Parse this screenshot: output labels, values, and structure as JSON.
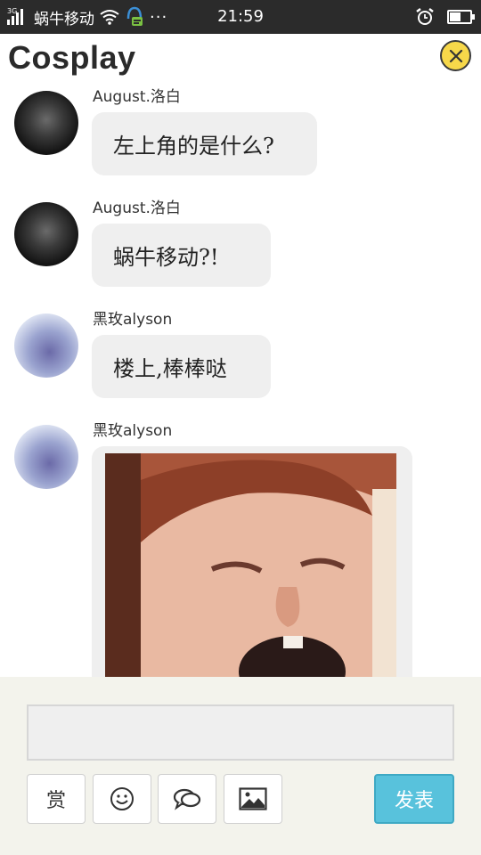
{
  "status_bar": {
    "network": "3G",
    "carrier": "蜗牛移动",
    "more": "···",
    "time": "21:59"
  },
  "header": {
    "title": "Cosplay"
  },
  "messages": [
    {
      "user": "August.洛白",
      "text": "左上角的是什么?"
    },
    {
      "user": "August.洛白",
      "text": "蜗牛移动?!"
    },
    {
      "user": "黑玫alyson",
      "text": "楼上,棒棒哒"
    },
    {
      "user": "黑玫alyson",
      "image": "photo-face"
    }
  ],
  "composer": {
    "reward_label": "赏",
    "post_label": "发表"
  },
  "colors": {
    "status_bar_bg": "#2b2b2b",
    "close_button": "#f7d84a",
    "bubble_bg": "#efefef",
    "post_button": "#58c2dc",
    "composer_bg": "#f3f3ec"
  },
  "icons": [
    "signal-icon",
    "wifi-icon",
    "notification-icon",
    "alarm-icon",
    "battery-icon",
    "close-icon",
    "smiley-icon",
    "chat-icon",
    "image-icon"
  ]
}
